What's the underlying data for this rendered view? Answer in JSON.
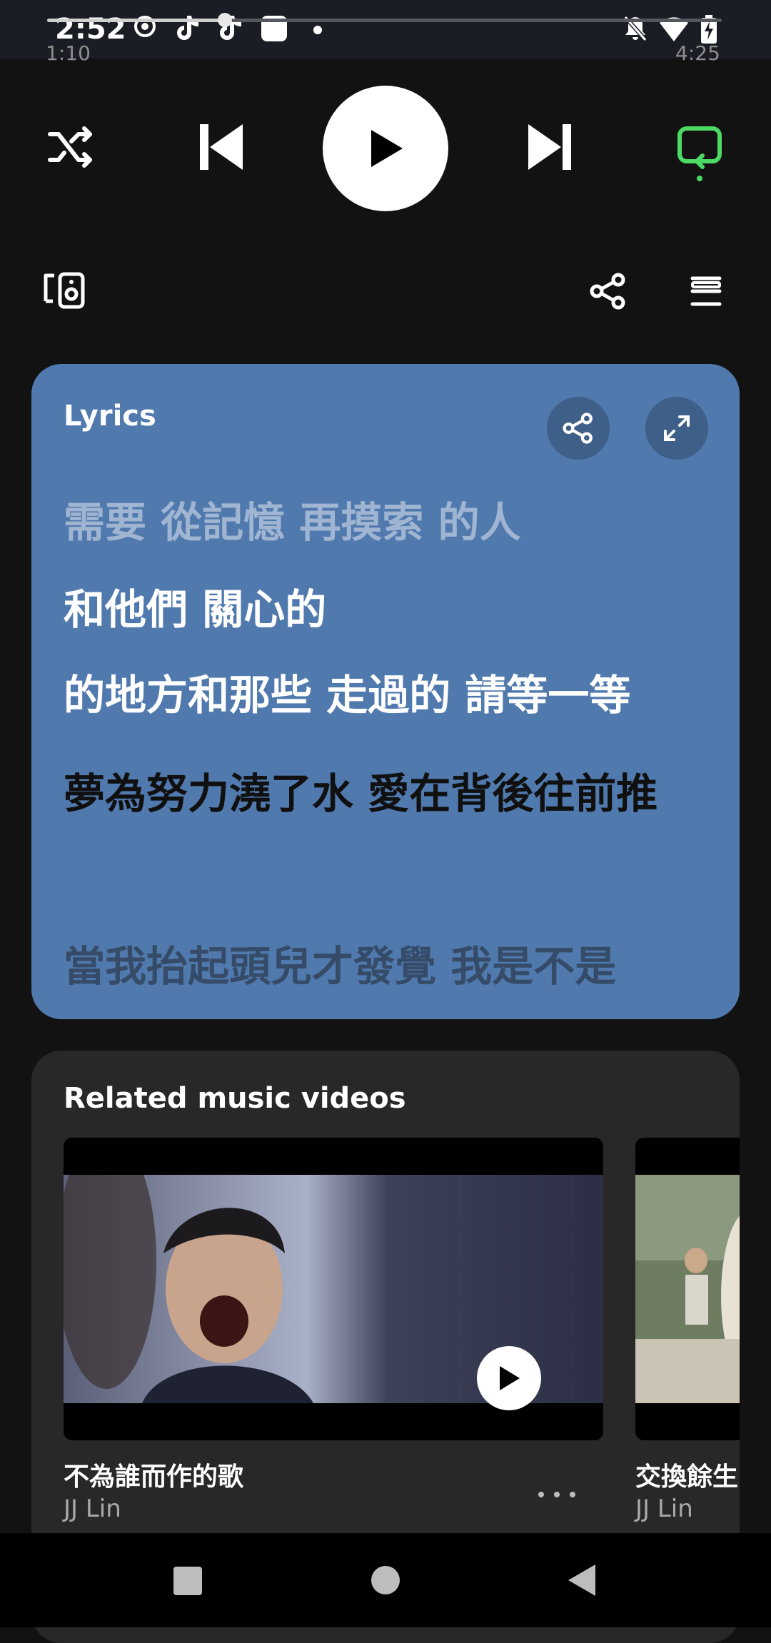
{
  "status_bar": {
    "time": "2:52"
  },
  "player": {
    "elapsed": "1:10",
    "duration": "4:25",
    "progress_fraction": 0.264,
    "repeat_color": "#4cd964"
  },
  "lyrics": {
    "title": "Lyrics",
    "lines": [
      "需要 從記憶 再摸索 的人",
      "和他們 關心的",
      "的地方和那些 走過的 請等一等",
      "夢為努力澆了水 愛在背後往前推",
      "當我抬起頭兒才發覺 我是不是"
    ],
    "card_color": "#5079ad"
  },
  "related": {
    "title": "Related music videos",
    "videos": [
      {
        "title": "不為誰而作的歌",
        "artist": "JJ Lin"
      },
      {
        "title": "交換餘生",
        "artist": "JJ Lin"
      }
    ]
  }
}
